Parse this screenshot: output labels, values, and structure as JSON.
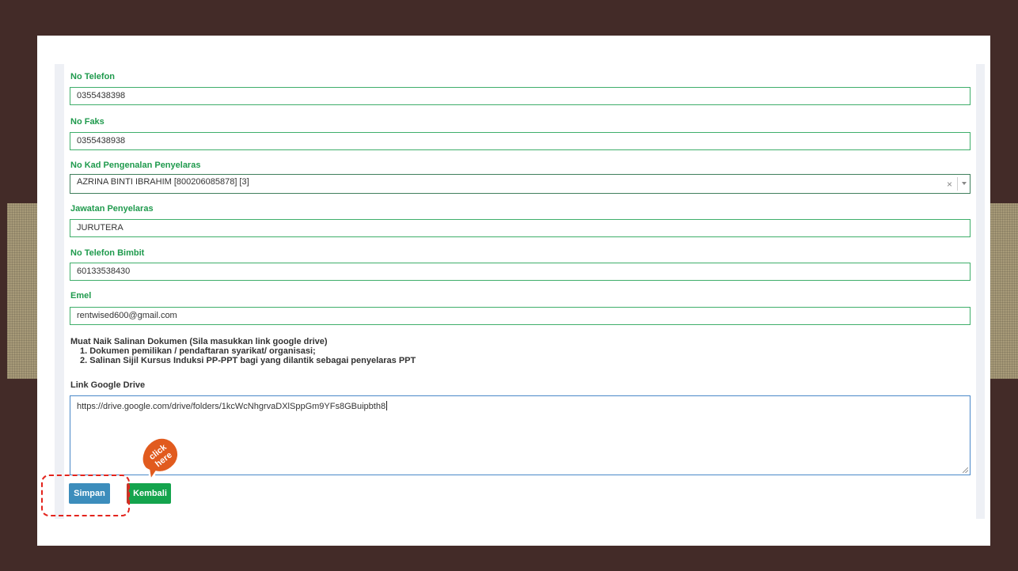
{
  "form": {
    "phone_label": "No Telefon",
    "phone_value": "0355438398",
    "fax_label": "No Faks",
    "fax_value": "0355438938",
    "ic_label": "No Kad Pengenalan Penyelaras",
    "ic_value": "AZRINA BINTI IBRAHIM [800206085878] [3]",
    "ic_clear": "×",
    "position_label": "Jawatan Penyelaras",
    "position_value": "JURUTERA",
    "mobile_label": "No Telefon Bimbit",
    "mobile_value": "60133538430",
    "email_label": "Emel",
    "email_value": "rentwised600@gmail.com",
    "upload_title": "Muat Naik Salinan Dokumen (Sila masukkan link google drive)",
    "upload_items": [
      "1. Dokumen pemilikan / pendaftaran syarikat/ organisasi;",
      "2. Salinan Sijil Kursus Induksi PP-PPT bagi yang dilantik sebagai penyelaras PPT"
    ],
    "drive_label": "Link Google Drive",
    "drive_value": "https://drive.google.com/drive/folders/1kcWcNhgrvaDXlSppGm9YFs8GBuipbth8"
  },
  "buttons": {
    "save_label": "Simpan",
    "back_label": "Kembali"
  },
  "annotation": {
    "badge_text_line1": "click",
    "badge_text_line2": "here",
    "highlight_color": "#e3231c"
  },
  "colors": {
    "label_green": "#1f9a4d",
    "field_border": "#3fae6a",
    "save_blue": "#3c8dbc",
    "back_green": "#14a44d",
    "frame_brown": "#432b28"
  }
}
